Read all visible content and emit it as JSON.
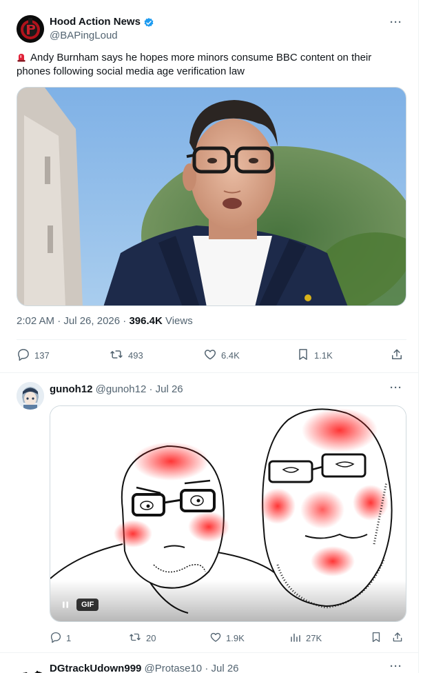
{
  "main_tweet": {
    "author_name": "Hood Action News",
    "handle": "@BAPingLoud",
    "more": "···",
    "text": "Andy Burnham says he hopes more minors consume BBC content on their phones following social media age verification law",
    "timestamp": "2:02 AM · Jul 26, 2026 · ",
    "views_count": "396.4K",
    "views_label": " Views",
    "actions": {
      "replies": "137",
      "reposts": "493",
      "likes": "6.4K",
      "bookmarks": "1.1K"
    }
  },
  "reply_tweet": {
    "author_name": "gunoh12",
    "handle": "@gunoh12",
    "date": " · Jul 26",
    "more": "···",
    "gif_badge": "GIF",
    "actions": {
      "replies": "1",
      "reposts": "20",
      "likes": "1.9K",
      "views": "27K"
    }
  },
  "partial_tweet": {
    "author_name": "DGtrackUdown999",
    "handle": "@Protase10",
    "date": " · Jul 26",
    "more": "···"
  },
  "colors": {
    "text": "#0f1419",
    "muted": "#536471",
    "verified": "#1d9bf0",
    "border": "#eff3f4",
    "siren": "#e0243a"
  },
  "icons": [
    "verified-badge-icon",
    "siren-icon",
    "reply-icon",
    "repost-icon",
    "like-icon",
    "bookmark-icon",
    "share-icon",
    "views-icon",
    "pause-icon"
  ]
}
